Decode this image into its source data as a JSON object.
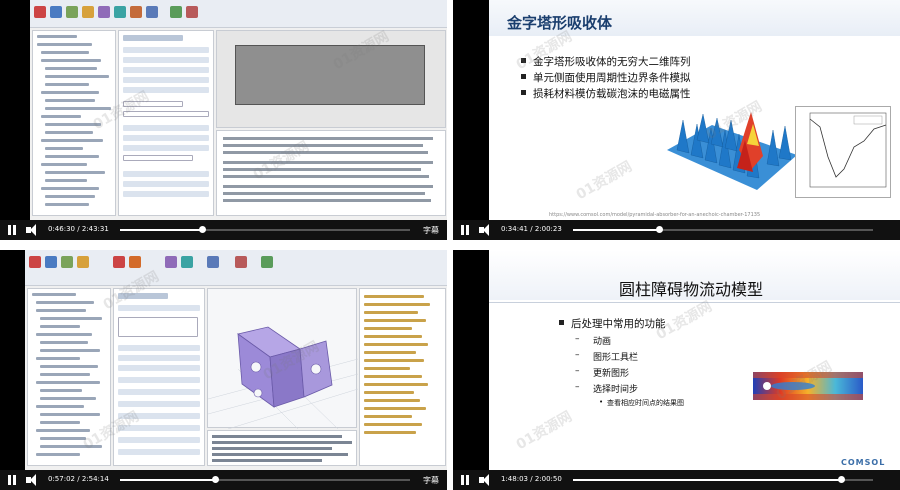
{
  "videos": [
    {
      "id_label": "tile-1",
      "current_time": "0:46:30",
      "duration": "2:43:31",
      "progress": 0.284,
      "subtitle_label": "字幕"
    },
    {
      "id_label": "tile-2",
      "current_time": "0:34:41",
      "duration": "2:00:23",
      "progress": 0.288,
      "subtitle_label": "",
      "slide": {
        "title": "金字塔形吸收体",
        "bullets": [
          "金字塔形吸收体的无穷大二维阵列",
          "单元侧面使用周期性边界条件模拟",
          "损耗材料模仿载碳泡沫的电磁属性"
        ],
        "url": "https://www.comsol.com/model/pyramidal-absorber-for-an-anechoic-chamber-17135"
      }
    },
    {
      "id_label": "tile-3",
      "current_time": "0:57:02",
      "duration": "2:54:14",
      "progress": 0.327,
      "subtitle_label": "字幕"
    },
    {
      "id_label": "tile-4",
      "current_time": "1:48:03",
      "duration": "2:00:50",
      "progress": 0.894,
      "subtitle_label": "",
      "slide": {
        "title": "圆柱障碍物流动模型",
        "bullets": [
          "后处理中常用的功能"
        ],
        "subs": [
          "动画",
          "图形工具栏",
          "更新图形",
          "选择时间步"
        ],
        "subsub": [
          "查看相应时间点的结果图"
        ],
        "logo": "COMSOL"
      }
    }
  ],
  "watermark": "01资源网",
  "colors": {
    "accent": "#1a3e6e",
    "bar": "#111111",
    "progress": "#ffffff"
  }
}
